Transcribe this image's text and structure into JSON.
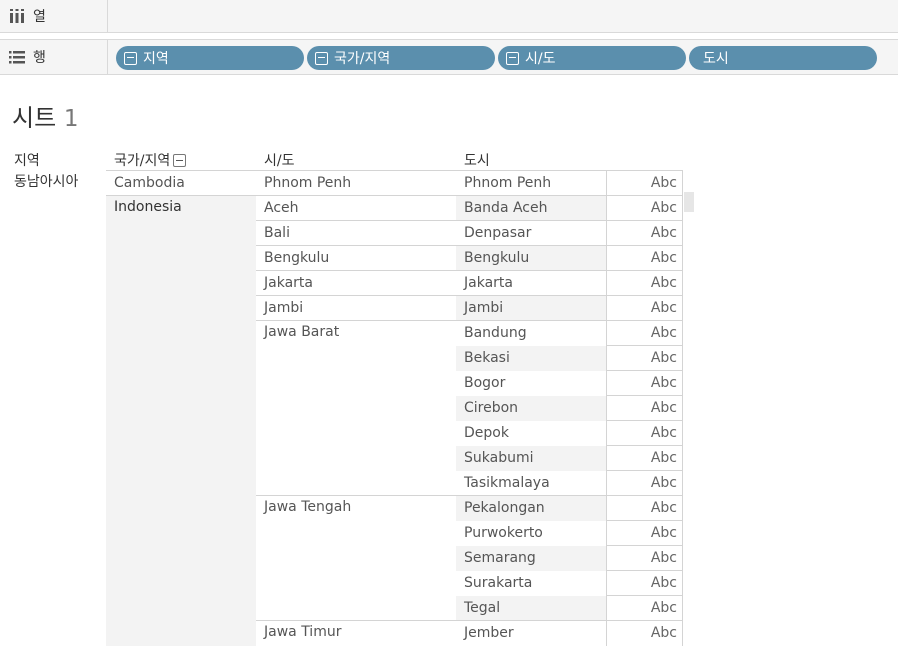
{
  "shelves": {
    "columns": {
      "label": "열",
      "icon": "columns-icon"
    },
    "rows": {
      "label": "행",
      "icon": "rows-icon",
      "pills": [
        {
          "label": "지역",
          "collapsible": true
        },
        {
          "label": "국가/지역",
          "collapsible": true
        },
        {
          "label": "시/도",
          "collapsible": true
        },
        {
          "label": "도시",
          "collapsible": false
        }
      ]
    }
  },
  "sheet": {
    "title": "시트",
    "title_num": "1",
    "headers": {
      "region": "지역",
      "country": "국가/지역",
      "state": "시/도",
      "city": "도시"
    },
    "region_value": "동남아시아",
    "countries": [
      "Cambodia",
      "Indonesia"
    ],
    "states": [
      "Phnom Penh",
      "Aceh",
      "Bali",
      "Bengkulu",
      "Jakarta",
      "Jambi",
      "Jawa Barat",
      "Jawa Tengah",
      "Jawa Timur"
    ],
    "cities": [
      "Phnom Penh",
      "Banda Aceh",
      "Denpasar",
      "Bengkulu",
      "Jakarta",
      "Jambi",
      "Bandung",
      "Bekasi",
      "Bogor",
      "Cirebon",
      "Depok",
      "Sukabumi",
      "Tasikmalaya",
      "Pekalongan",
      "Purwokerto",
      "Semarang",
      "Surakarta",
      "Tegal",
      "Jember"
    ],
    "cell_text": "Abc"
  }
}
